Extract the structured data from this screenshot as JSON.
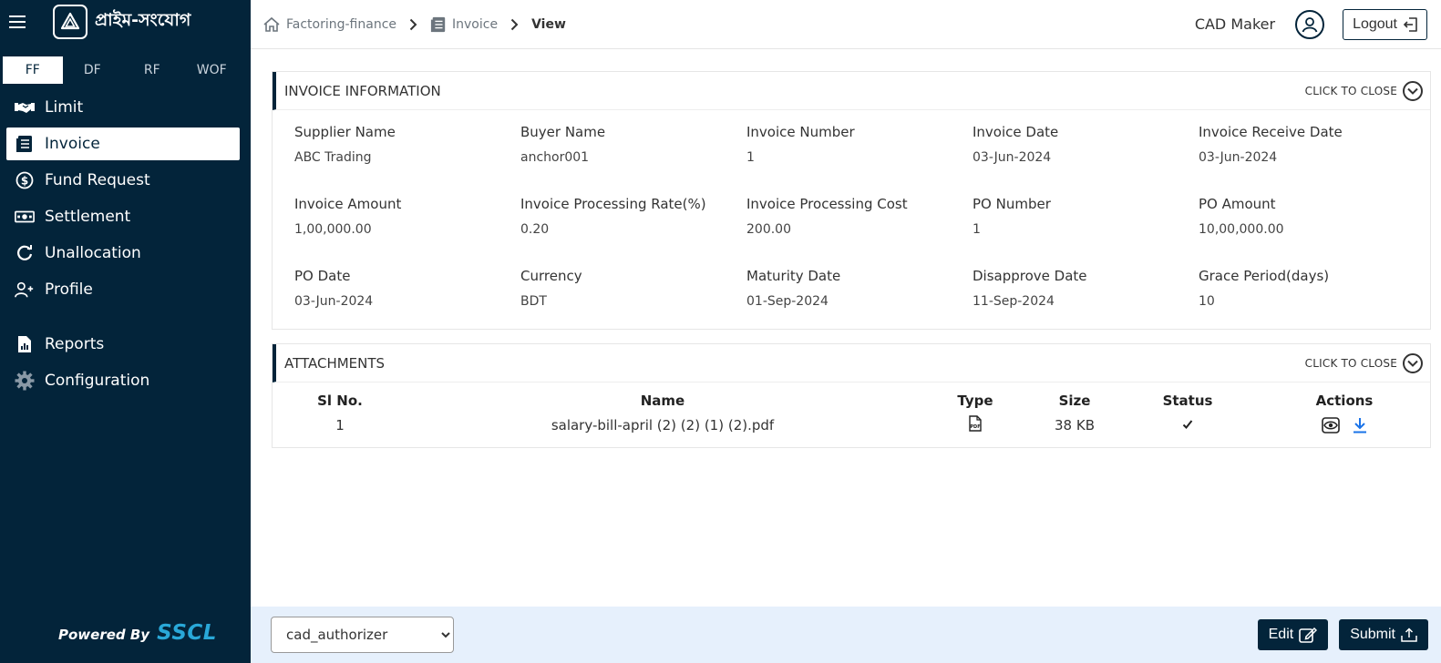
{
  "brand": {
    "name": "প্রাইম-সংযোগ",
    "powered_by": "Powered By",
    "powered_brand": "SSCL"
  },
  "sidebar": {
    "tabs": [
      {
        "label": "FF",
        "active": true
      },
      {
        "label": "DF",
        "active": false
      },
      {
        "label": "RF",
        "active": false
      },
      {
        "label": "WOF",
        "active": false
      }
    ],
    "items": [
      {
        "label": "Limit",
        "icon": "handshake-icon"
      },
      {
        "label": "Invoice",
        "icon": "document-icon",
        "active": true
      },
      {
        "label": "Fund Request",
        "icon": "coin-icon"
      },
      {
        "label": "Settlement",
        "icon": "banknote-icon"
      },
      {
        "label": "Unallocation",
        "icon": "refresh-icon"
      },
      {
        "label": "Profile",
        "icon": "user-plus-icon"
      }
    ],
    "items2": [
      {
        "label": "Reports",
        "icon": "report-icon"
      },
      {
        "label": "Configuration",
        "icon": "gear-icon"
      }
    ]
  },
  "breadcrumb": {
    "home": "Factoring-finance",
    "section": "Invoice",
    "current": "View"
  },
  "user": {
    "name": "CAD Maker",
    "logout_label": "Logout"
  },
  "invoice_info": {
    "title": "INVOICE INFORMATION",
    "toggle_label": "CLICK TO CLOSE",
    "fields": [
      {
        "label": "Supplier Name",
        "value": "ABC Trading"
      },
      {
        "label": "Buyer Name",
        "value": "anchor001"
      },
      {
        "label": "Invoice Number",
        "value": "1"
      },
      {
        "label": "Invoice Date",
        "value": "03-Jun-2024"
      },
      {
        "label": "Invoice Receive Date",
        "value": "03-Jun-2024"
      },
      {
        "label": "Invoice Amount",
        "value": "1,00,000.00"
      },
      {
        "label": "Invoice Processing Rate(%)",
        "value": "0.20"
      },
      {
        "label": "Invoice Processing Cost",
        "value": "200.00"
      },
      {
        "label": "PO Number",
        "value": "1"
      },
      {
        "label": "PO Amount",
        "value": "10,00,000.00"
      },
      {
        "label": "PO Date",
        "value": "03-Jun-2024"
      },
      {
        "label": "Currency",
        "value": "BDT"
      },
      {
        "label": "Maturity Date",
        "value": "01-Sep-2024"
      },
      {
        "label": "Disapprove Date",
        "value": "11-Sep-2024"
      },
      {
        "label": "Grace Period(days)",
        "value": "10"
      }
    ]
  },
  "attachments": {
    "title": "ATTACHMENTS",
    "toggle_label": "CLICK TO CLOSE",
    "columns": [
      "Sl No.",
      "Name",
      "Type",
      "Size",
      "Status",
      "Actions"
    ],
    "rows": [
      {
        "sl": "1",
        "name": "salary-bill-april (2) (2) (1) (2).pdf",
        "type_icon": "pdf-icon",
        "size": "38 KB",
        "status_icon": "check-icon"
      }
    ]
  },
  "footer": {
    "role_selected": "cad_authorizer",
    "edit_label": "Edit",
    "submit_label": "Submit"
  },
  "colors": {
    "sidebar_bg": "#03243a",
    "accent_blue": "#1a73e8",
    "footer_bg": "#e6f0fc",
    "brand_cyan": "#29a8d8"
  }
}
